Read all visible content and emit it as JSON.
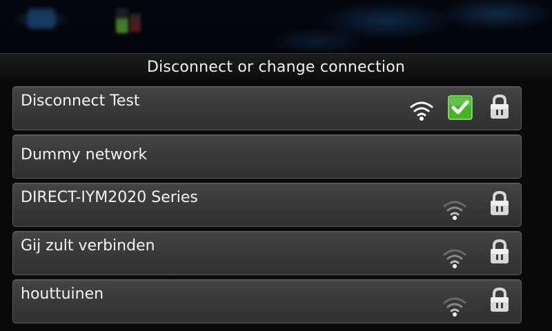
{
  "dialog": {
    "title": "Disconnect or change connection"
  },
  "networks": [
    {
      "name": "Disconnect Test",
      "signal_icon": "wifi-strong-icon",
      "connected": true,
      "secured": true
    },
    {
      "name": "Dummy network",
      "signal_icon": null,
      "connected": false,
      "secured": false
    },
    {
      "name": "DIRECT-IYM2020 Series",
      "signal_icon": "wifi-weak-icon",
      "connected": false,
      "secured": true
    },
    {
      "name": "Gij zult verbinden",
      "signal_icon": "wifi-weak-icon",
      "connected": false,
      "secured": true
    },
    {
      "name": "houttuinen",
      "signal_icon": "wifi-weak-icon",
      "connected": false,
      "secured": true
    }
  ],
  "colors": {
    "connected_check": "#3fb51f",
    "wifi_strong": "#ffffff",
    "wifi_weak": "#8a8a8a",
    "lock": "#d8d8d8"
  }
}
